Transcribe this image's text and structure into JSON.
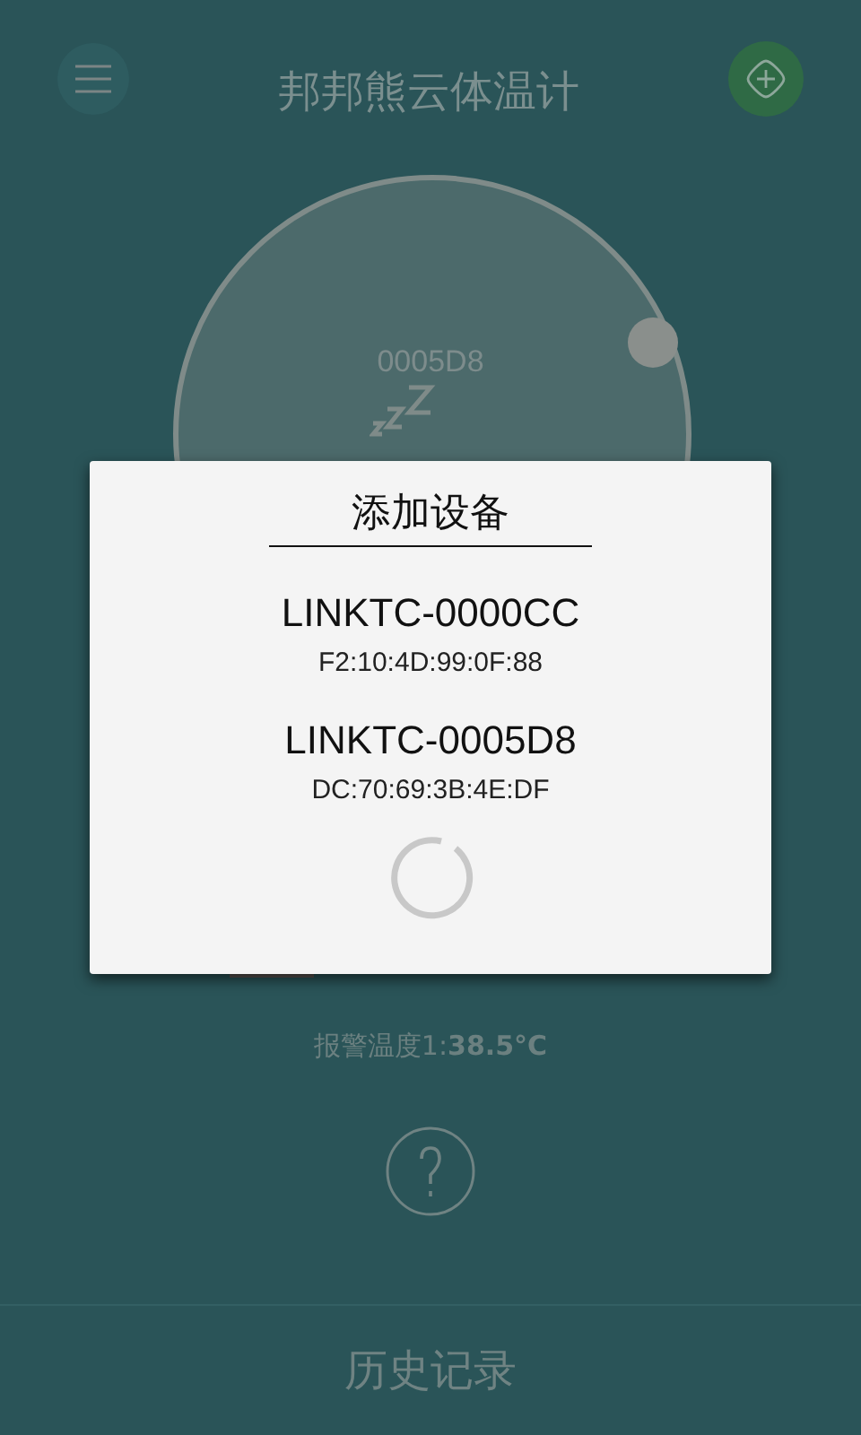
{
  "header": {
    "title": "邦邦熊云体温计"
  },
  "dial": {
    "device_id": "0005D8"
  },
  "alarm": "报警温度1:**38.5°C**",
  "bottom_bar": {
    "label": "历史记录"
  },
  "dialog": {
    "title": "添加设备",
    "loading": true,
    "devices": [
      {
        "name": "LINKTC-0000CC",
        "mac": "F2:10:4D:99:0F:88"
      },
      {
        "name": "LINKTC-0005D8",
        "mac": "DC:70:69:3B:4E:DF"
      }
    ]
  }
}
